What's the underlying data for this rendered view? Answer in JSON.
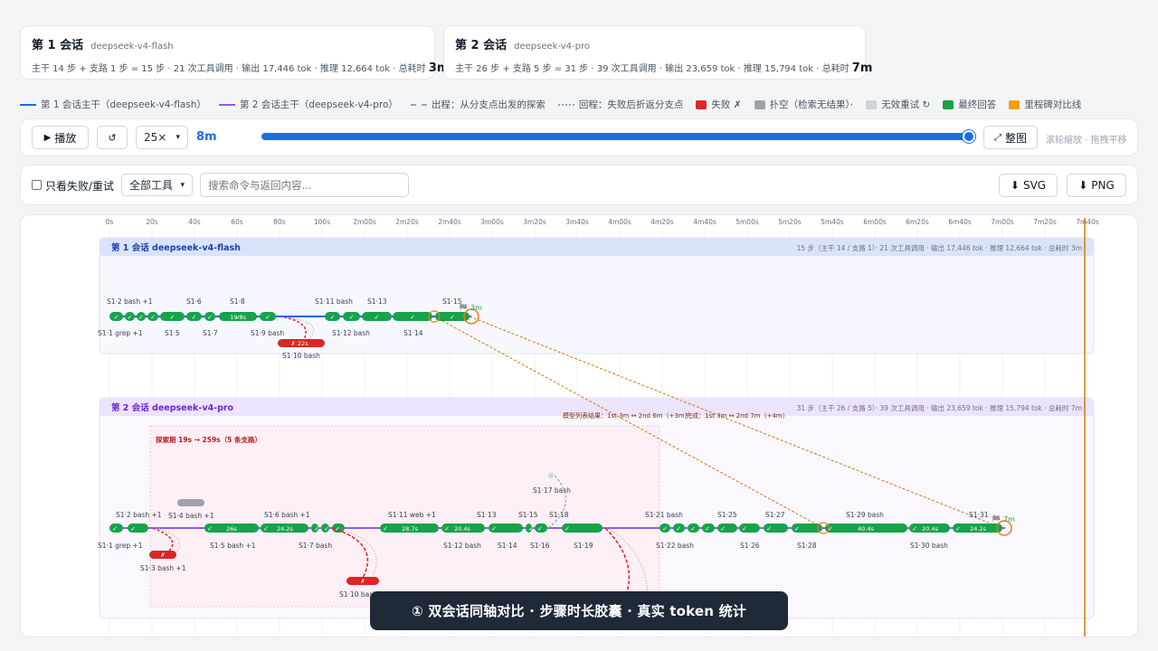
{
  "session1": {
    "title": "第 1 会话",
    "model": "deepseek-v4-flash",
    "stats_prefix": "主干 14 步 + 支路 1 步 = 15 步 · 21 次工具调用 · 输出 17,446 tok · 推理 12,664 tok · 总耗时",
    "total": "3m"
  },
  "session2": {
    "title": "第 2 会话",
    "model": "deepseek-v4-pro",
    "stats_prefix": "主干 26 步 + 支路 5 步 = 31 步 · 39 次工具调用 · 输出 23,659 tok · 推理 15,794 tok · 总耗时",
    "total": "7m"
  },
  "legend": [
    {
      "label": "第 1 会话主干（deepseek-v4-flash）",
      "kind": "line",
      "color": "#2563eb"
    },
    {
      "label": "第 2 会话主干（deepseek-v4-pro）",
      "kind": "line",
      "color": "#8b5cf6"
    },
    {
      "label": "出程：从分支点出发的探索",
      "kind": "dash",
      "color": "#9ca3af"
    },
    {
      "label": "回程：失败后折返分支点",
      "kind": "dot",
      "color": "#9ca3af"
    },
    {
      "label": "失败 ✗",
      "kind": "swatch",
      "color": "#dc2626"
    },
    {
      "label": "扑空（检索无结果）·",
      "kind": "swatch",
      "color": "#9ca3af"
    },
    {
      "label": "无效重试 ↻",
      "kind": "swatch",
      "color": "#cbd5e1"
    },
    {
      "label": "最终回答",
      "kind": "swatch",
      "color": "#16a34a"
    },
    {
      "label": "里程碑对比线",
      "kind": "swatch",
      "color": "#f59e0b"
    }
  ],
  "controls": {
    "play": "播放",
    "reset": "↺",
    "speed": "25×",
    "elapsed": "8m",
    "fit": "整图",
    "hint": "滚轮缩放 · 拖拽平移"
  },
  "filters": {
    "fail_only": "只看失败/重试",
    "tool_select": "全部工具",
    "search_placeholder": "搜索命令与返回内容...",
    "export_svg": "SVG",
    "export_png": "PNG"
  },
  "timeline": {
    "ticks": [
      "0s",
      "20s",
      "40s",
      "60s",
      "80s",
      "100s",
      "2m00s",
      "2m20s",
      "2m40s",
      "3m00s",
      "3m20s",
      "3m40s",
      "4m00s",
      "4m20s",
      "4m40s",
      "5m00s",
      "5m20s",
      "5m40s",
      "6m00s",
      "6m20s",
      "6m40s",
      "7m00s",
      "7m20s",
      "7m40s"
    ],
    "lane1": {
      "title": "第 1 会话 deepseek-v4-flash",
      "stats": "15 步（主干 14 / 支路 1）· 21 次工具调用 · 输出 17,446 tok · 推理 12,664 tok · 总耗时 3m"
    },
    "lane2": {
      "title": "第 2 会话 deepseek-v4-pro",
      "stats": "31 步（主干 26 / 支路 5）· 39 次工具调用 · 输出 23,659 tok · 推理 15,794 tok · 总耗时 7m",
      "explore": "探索期 19s → 259s（5 条支路）",
      "milestone_note": "模型列表结果：1st 3m ↔ 2nd 6m（+3m）",
      "milestone_note2": "完成：1st 3m ↔ 2nd 7m（+4m）"
    },
    "s1_top_labels": [
      "S1·2 bash +1",
      "S1·6",
      "S1·8",
      "S1·11 bash",
      "S1·13",
      "S1·15"
    ],
    "s1_bottom_labels": [
      "S1·1 grep +1",
      "S1·5",
      "S1·7",
      "S1·9 bash",
      "S1·12 bash",
      "S1·14"
    ],
    "s1_branch": {
      "label": "S1·10 bash",
      "dur": "22s"
    },
    "s1_cap_dur": "19.8s",
    "s1_end": "3m",
    "s2_top_labels": [
      "S1·2 bash +1",
      "S1·4 bash +1",
      "S1·6 bash +1",
      "S1·11 web +1",
      "S1·13",
      "S1·15",
      "S1·18",
      "S1·17 bash",
      "S1·21 bash",
      "S1·25",
      "S1·27",
      "S1·29 bash",
      "S1·31"
    ],
    "s2_bottom_labels": [
      "S1·1 grep +1",
      "S1·3 bash +1",
      "S1·5 bash +1",
      "S1·7 bash",
      "S1·10 bash",
      "S1·12 bash",
      "S1·14",
      "S1·16",
      "S1·19",
      "S1·22 bash",
      "S1·26",
      "S1·28",
      "S1·30 bash"
    ],
    "s2_durs": [
      "26s",
      "24.2s",
      "28.7s",
      "20.4s",
      "40.4s",
      "20.4s",
      "24.2s"
    ],
    "s2_end": "7m"
  },
  "caption": "① 双会话同轴对比 · 步骤时长胶囊 · 真实 token 统计"
}
